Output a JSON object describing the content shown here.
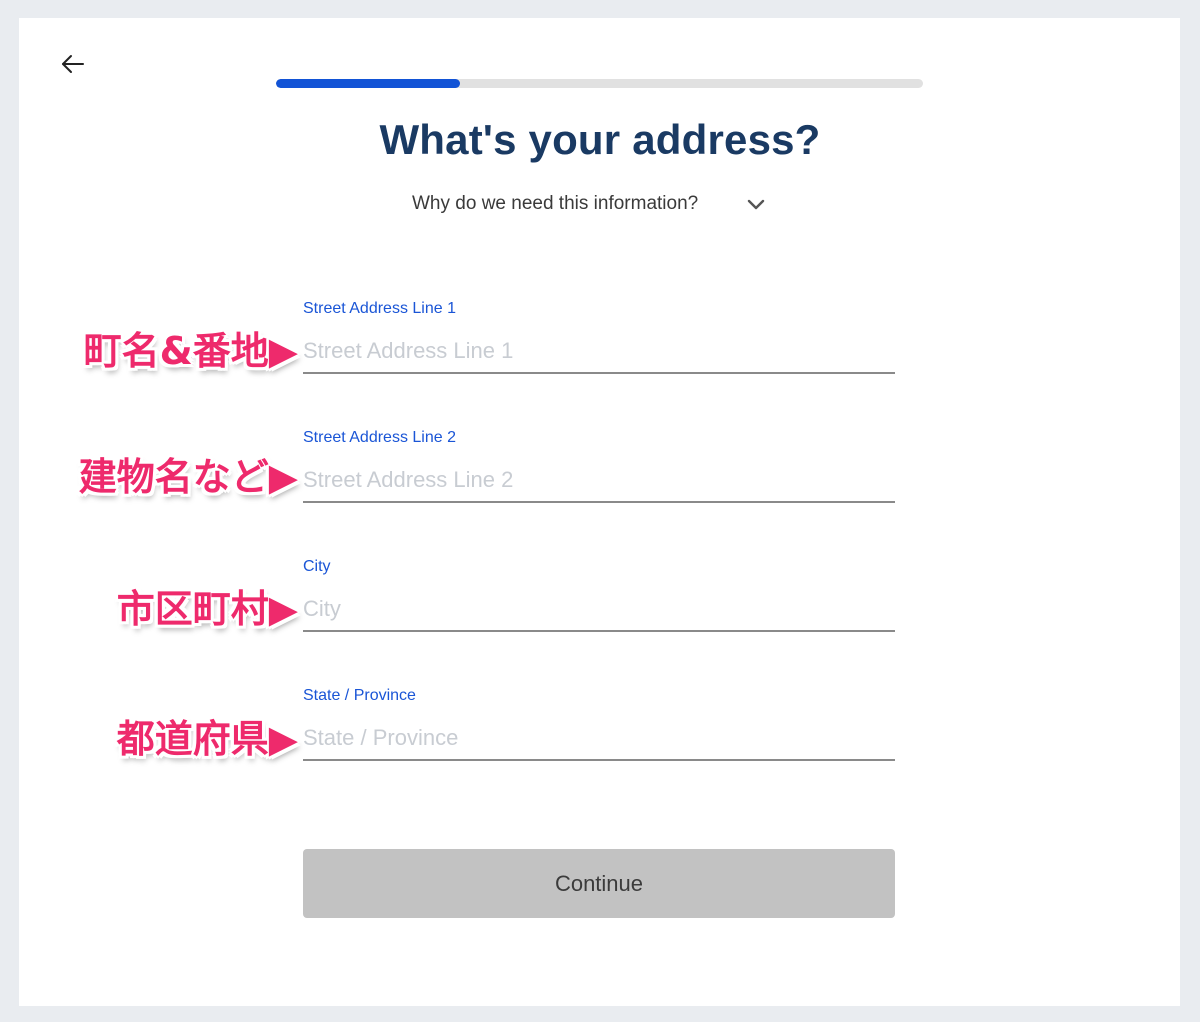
{
  "header": {
    "back_icon": "arrow-left-icon",
    "progress_fraction": 0.284,
    "progress_color": "#1253d6",
    "title": "What's your address?",
    "why_text": "Why do we need this information?",
    "why_icon": "chevron-down-icon"
  },
  "fields": {
    "street1": {
      "label": "Street Address Line 1",
      "placeholder": "Street Address Line 1",
      "value": ""
    },
    "street2": {
      "label": "Street Address Line 2",
      "placeholder": "Street Address Line 2",
      "value": ""
    },
    "city": {
      "label": "City",
      "placeholder": "City",
      "value": ""
    },
    "state": {
      "label": "State / Province",
      "placeholder": "State / Province",
      "value": ""
    }
  },
  "annotations": {
    "street1": "町名&番地▶",
    "street2": "建物名など▶",
    "city": "市区町村▶",
    "state": "都道府県▶",
    "color": "#ee2a6c"
  },
  "actions": {
    "continue_label": "Continue"
  }
}
